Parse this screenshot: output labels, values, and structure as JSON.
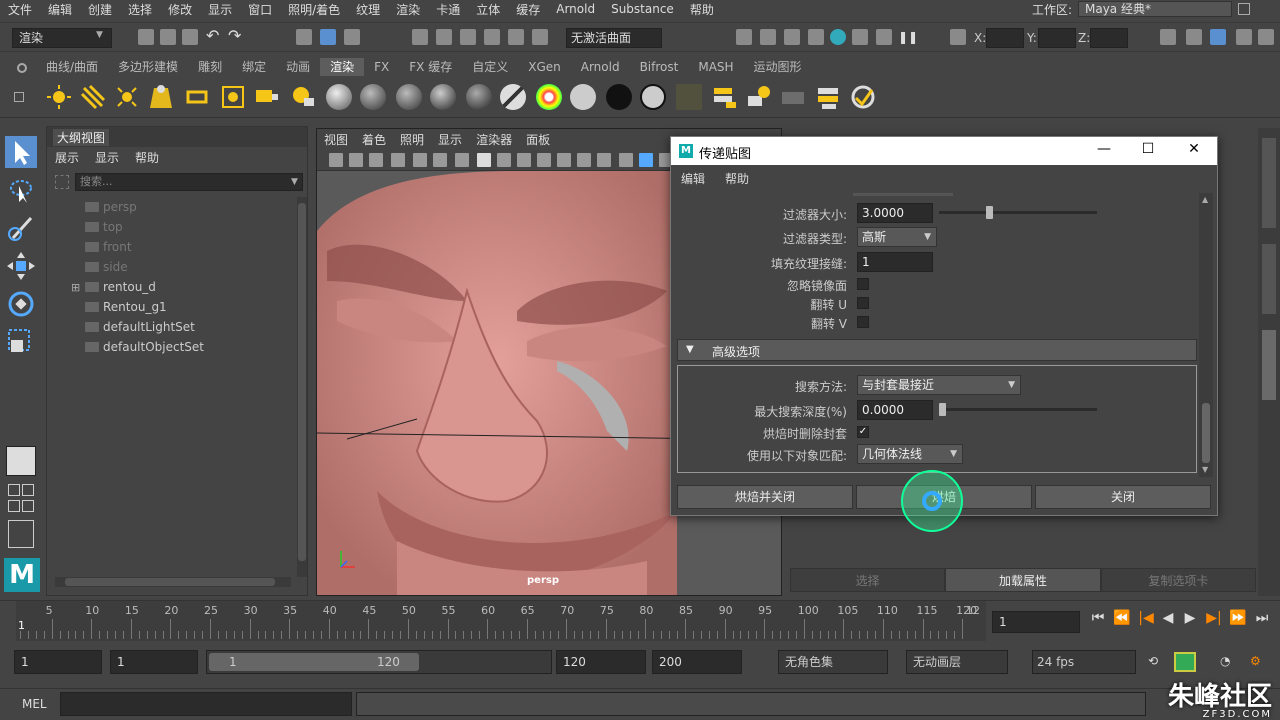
{
  "menubar": [
    "文件",
    "编辑",
    "创建",
    "选择",
    "修改",
    "显示",
    "窗口",
    "照明/着色",
    "纹理",
    "渲染",
    "卡通",
    "立体",
    "缓存",
    "Arnold",
    "Substance",
    "帮助"
  ],
  "workspace": {
    "label": "工作区:",
    "value": "Maya 经典*"
  },
  "statusline": {
    "mode": "渲染",
    "surface": "无激活曲面",
    "x_label": "X:",
    "y_label": "Y:",
    "z_label": "Z:"
  },
  "shelf_tabs": [
    "曲线/曲面",
    "多边形建模",
    "雕刻",
    "绑定",
    "动画",
    "渲染",
    "FX",
    "FX 缓存",
    "自定义",
    "XGen",
    "Arnold",
    "Bifrost",
    "MASH",
    "运动图形"
  ],
  "shelf_active_index": 5,
  "outliner": {
    "title": "大纲视图",
    "menu": [
      "展示",
      "显示",
      "帮助"
    ],
    "search_placeholder": "搜索...",
    "items": [
      {
        "label": "persp",
        "dim": true
      },
      {
        "label": "top",
        "dim": true
      },
      {
        "label": "front",
        "dim": true
      },
      {
        "label": "side",
        "dim": true
      },
      {
        "label": "rentou_d",
        "dim": false
      },
      {
        "label": "Rentou_g1",
        "dim": false
      },
      {
        "label": "defaultLightSet",
        "dim": false
      },
      {
        "label": "defaultObjectSet",
        "dim": false
      }
    ]
  },
  "viewport": {
    "menu": [
      "视图",
      "着色",
      "照明",
      "显示",
      "渲染器",
      "面板"
    ],
    "camera_label": "persp",
    "colors": {
      "skin": "#d9958f",
      "skin_shadow": "#a9635e",
      "background": "#5a5a5a"
    }
  },
  "dialog": {
    "title": "传递贴图",
    "menu": [
      "编辑",
      "帮助"
    ],
    "rows": {
      "filter_size": {
        "label": "过滤器大小:",
        "value": "3.0000",
        "slider": 0.3
      },
      "filter_type": {
        "label": "过滤器类型:",
        "value": "高斯"
      },
      "fill_seams": {
        "label": "填充纹理接缝:",
        "value": "1"
      },
      "ignore_mirror": {
        "label": "忽略镜像面"
      },
      "flip_u": {
        "label": "翻转 U"
      },
      "flip_v": {
        "label": "翻转 V"
      }
    },
    "advanced": {
      "title": "高级选项",
      "search_method": {
        "label": "搜索方法:",
        "value": "与封套最接近"
      },
      "max_depth": {
        "label": "最大搜索深度(%)",
        "value": "0.0000",
        "slider": 0.0
      },
      "delete_envelope": {
        "label": "烘焙时删除封套",
        "checked_glyph": "✓"
      },
      "match_using": {
        "label": "使用以下对象匹配:",
        "value": "几何体法线"
      }
    },
    "buttons": {
      "bake_close": "烘焙并关闭",
      "bake": "烘焙",
      "close": "关闭"
    }
  },
  "right_panel_tabs": [
    "选择",
    "加载属性",
    "复制选项卡"
  ],
  "right_panel_active": 1,
  "timeline": {
    "ticks": [
      5,
      10,
      15,
      20,
      25,
      30,
      35,
      40,
      45,
      50,
      55,
      60,
      65,
      70,
      75,
      80,
      85,
      90,
      95,
      100,
      105,
      110,
      115,
      120
    ],
    "current_frame": "1",
    "start_field": "1",
    "playback_start": "1",
    "range_start": "1",
    "range_end": "120",
    "playback_end": "120",
    "anim_end": "200",
    "char_set": "无角色集",
    "anim_layer": "无动画层",
    "fps": "24 fps",
    "first_tick": "1",
    "last_tick": "12"
  },
  "cmdline": {
    "label": "MEL"
  },
  "watermark": {
    "main": "朱峰社区",
    "sub": "ZF3D.COM"
  }
}
